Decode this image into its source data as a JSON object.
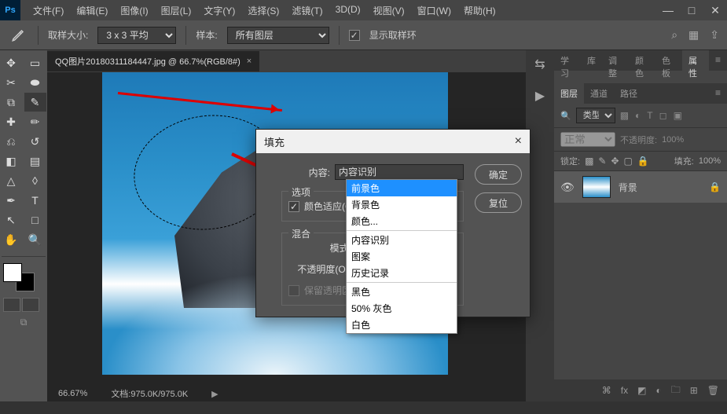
{
  "menubar": {
    "items": [
      "文件(F)",
      "编辑(E)",
      "图像(I)",
      "图层(L)",
      "文字(Y)",
      "选择(S)",
      "滤镜(T)",
      "3D(D)",
      "视图(V)",
      "窗口(W)",
      "帮助(H)"
    ]
  },
  "options": {
    "sample_size_label": "取样大小:",
    "sample_size_value": "3 x 3 平均",
    "sample_label": "样本:",
    "sample_value": "所有图层",
    "show_ring_label": "显示取样环"
  },
  "document": {
    "tab_title": "QQ图片20180311184447.jpg @ 66.7%(RGB/8#)",
    "zoom": "66.67%",
    "status": "文档:975.0K/975.0K"
  },
  "panels": {
    "top_tabs": [
      "学习",
      "库",
      "调整",
      "颜色",
      "色板",
      "属性"
    ],
    "layer_tabs": [
      "图层",
      "通道",
      "路径"
    ],
    "kind_label": "类型",
    "blend_normal": "正常",
    "opacity_label": "不透明度:",
    "opacity_value": "100%",
    "lock_label": "锁定:",
    "fill_label": "填充:",
    "fill_value": "100%",
    "layer_name": "背景"
  },
  "dialog": {
    "title": "填充",
    "content_label": "内容:",
    "content_value": "内容识别",
    "options_legend": "选项",
    "color_adapt_label": "颜色适应(C)",
    "blend_legend": "混合",
    "mode_label": "模式:",
    "opacity_label": "不透明度(O):",
    "preserve_trans_label": "保留透明区域",
    "ok": "确定",
    "reset": "复位"
  },
  "dropdown": {
    "items": [
      {
        "label": "前景色",
        "selected": true
      },
      {
        "label": "背景色"
      },
      {
        "label": "颜色..."
      },
      {
        "sep": true
      },
      {
        "label": "内容识别"
      },
      {
        "label": "图案"
      },
      {
        "label": "历史记录"
      },
      {
        "sep": true
      },
      {
        "label": "黑色"
      },
      {
        "label": "50% 灰色"
      },
      {
        "label": "白色"
      }
    ]
  }
}
